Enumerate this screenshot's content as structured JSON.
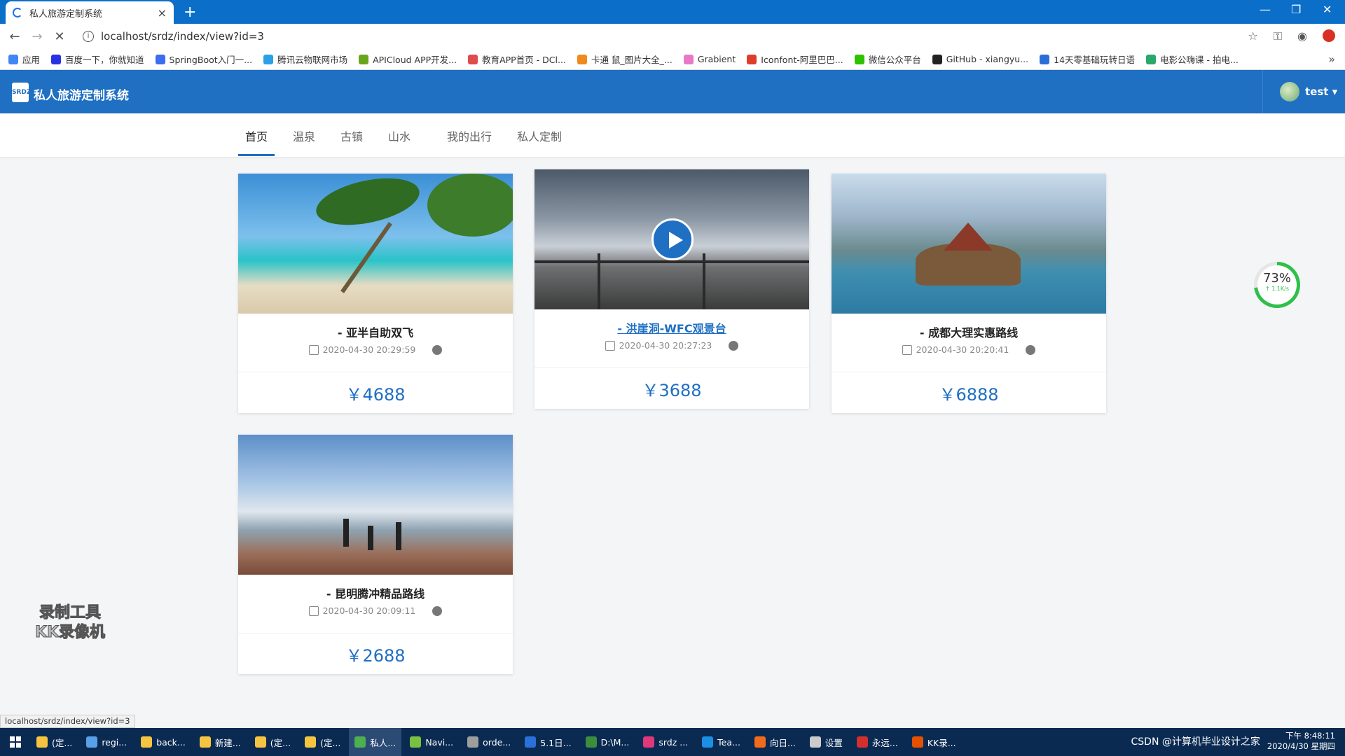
{
  "browser": {
    "tab_title": "私人旅游定制系统",
    "tab_close": "×",
    "new_tab": "+",
    "url": "localhost/srdz/index/view?id=3",
    "bookmarks": [
      {
        "label": "应用",
        "color": "#4285f4"
      },
      {
        "label": "百度一下，你就知道",
        "color": "#2932e1"
      },
      {
        "label": "SpringBoot入门一...",
        "color": "#3c6df0"
      },
      {
        "label": "腾讯云物联网市场",
        "color": "#2aa0e8"
      },
      {
        "label": "APICloud APP开发...",
        "color": "#6aa51e"
      },
      {
        "label": "教育APP首页 - DCl...",
        "color": "#e04b4b"
      },
      {
        "label": "卡通 鼠_图片大全_...",
        "color": "#f08a1c"
      },
      {
        "label": "Grabient",
        "color": "#e879c8"
      },
      {
        "label": "Iconfont-阿里巴巴...",
        "color": "#e03c2b"
      },
      {
        "label": "微信公众平台",
        "color": "#2dc100"
      },
      {
        "label": "GitHub - xiangyu...",
        "color": "#222222"
      },
      {
        "label": "14天零基础玩转日语",
        "color": "#2a6fd8"
      },
      {
        "label": "电影公嗨课 - 拍电...",
        "color": "#2aa86b"
      }
    ],
    "bookmarks_more": "»",
    "status_url": "localhost/srdz/index/view?id=3"
  },
  "app": {
    "title": "私人旅游定制系统",
    "logo_text": "SRDZ",
    "user": "test ▾"
  },
  "nav": {
    "tabs": [
      {
        "label": "首页",
        "active": true
      },
      {
        "label": "温泉",
        "active": false
      },
      {
        "label": "古镇",
        "active": false
      },
      {
        "label": "山水",
        "active": false
      },
      {
        "label": "我的出行",
        "active": false
      },
      {
        "label": "私人定制",
        "active": false
      }
    ]
  },
  "cards": [
    {
      "title": "- 亚半自助双飞",
      "date": "2020-04-30 20:29:59",
      "price": "￥4688",
      "image": "beach"
    },
    {
      "title": "- 洪崖洞-WFC观景台",
      "date": "2020-04-30 20:27:23",
      "price": "￥3688",
      "image": "wfc-video"
    },
    {
      "title": "- 成都大理实惠路线",
      "date": "2020-04-30 20:20:41",
      "price": "￥6888",
      "image": "dali"
    },
    {
      "title": "- 昆明腾冲精品路线",
      "date": "2020-04-30 20:09:11",
      "price": "￥2688",
      "image": "kunming"
    }
  ],
  "overlay": {
    "progress_percent": 73,
    "progress_label": "73%",
    "speed": "↑ 1.1K/s",
    "watermark_line1": "录制工具",
    "watermark_line2": "KK录像机"
  },
  "taskbar": {
    "items": [
      {
        "label": "(定...",
        "color": "#f5c542"
      },
      {
        "label": "regi...",
        "color": "#5aa0e6"
      },
      {
        "label": "back...",
        "color": "#f5c542"
      },
      {
        "label": "新建...",
        "color": "#f5c542"
      },
      {
        "label": "(定...",
        "color": "#f5c542"
      },
      {
        "label": "(定...",
        "color": "#f5c542"
      },
      {
        "label": "私人...",
        "color": "#4caf50",
        "active": true
      },
      {
        "label": "Navi...",
        "color": "#7ac142"
      },
      {
        "label": "orde...",
        "color": "#9e9e9e"
      },
      {
        "label": "5.1日...",
        "color": "#2b6fd8"
      },
      {
        "label": "D:\\M...",
        "color": "#3c8d3c"
      },
      {
        "label": "srdz ...",
        "color": "#e0387a"
      },
      {
        "label": "Tea...",
        "color": "#1a8fe3"
      },
      {
        "label": "向日...",
        "color": "#f26b1d"
      },
      {
        "label": "设置",
        "color": "#cccccc"
      },
      {
        "label": "永远...",
        "color": "#d32f2f"
      },
      {
        "label": "KK录...",
        "color": "#e65100"
      }
    ],
    "tray_text": "CSDN @计算机毕业设计之家",
    "time": "下午 8:48:11",
    "date": "2020/4/30 星期四"
  }
}
